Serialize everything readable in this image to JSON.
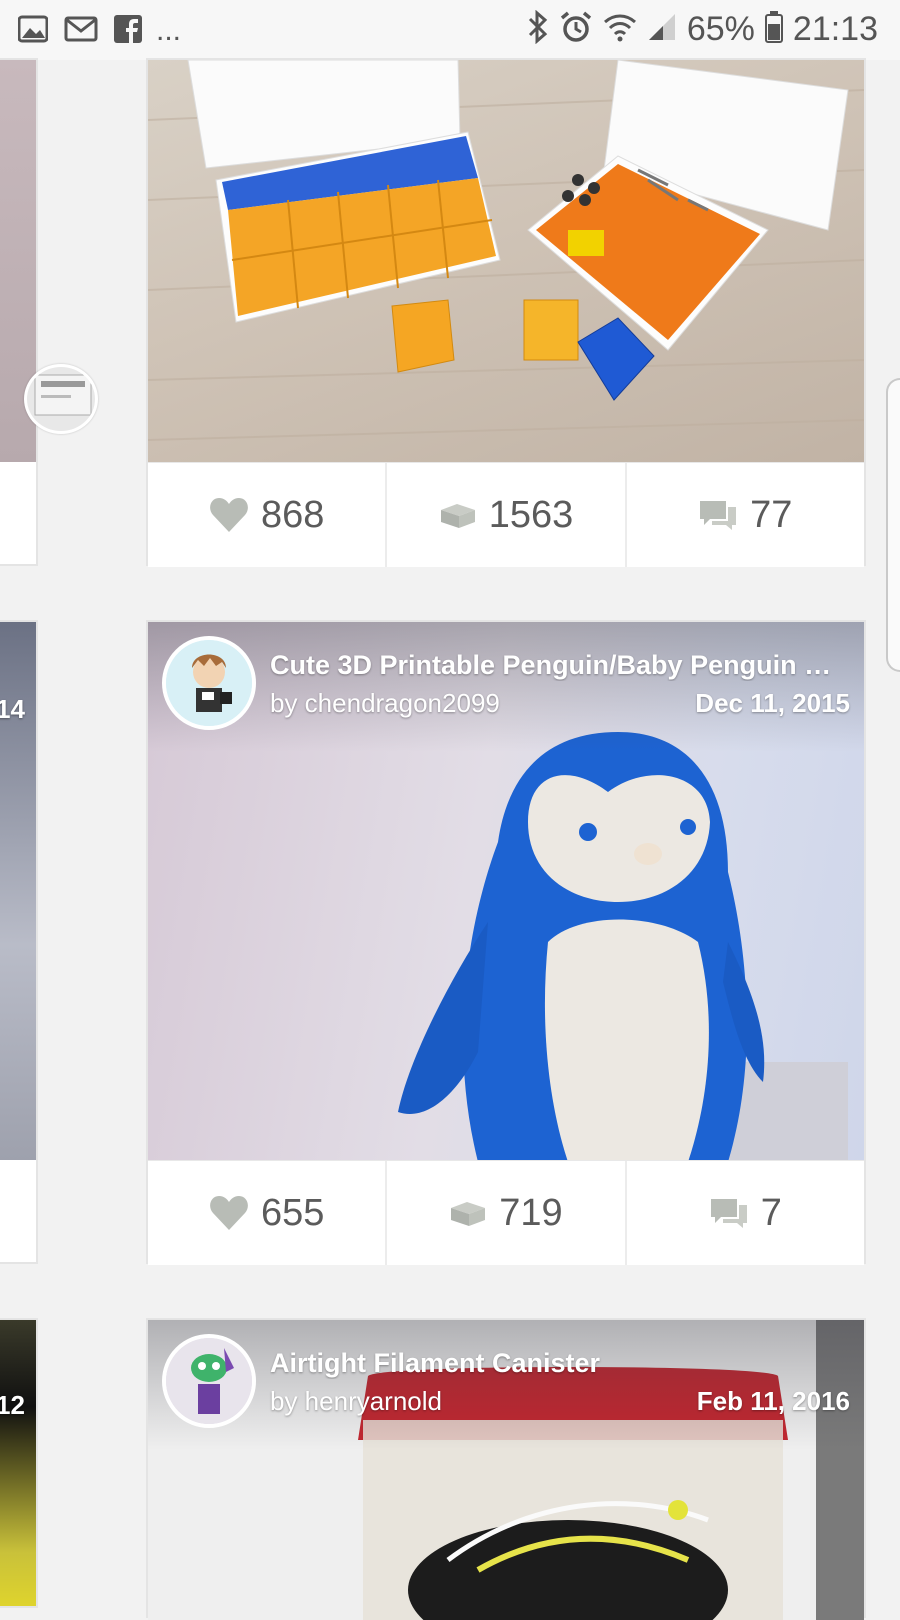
{
  "status_bar": {
    "left_icons": [
      "gallery-icon",
      "email-icon",
      "facebook-icon"
    ],
    "overflow": "...",
    "right_icons": [
      "bluetooth-icon",
      "alarm-icon",
      "wifi-icon",
      "signal-icon"
    ],
    "battery": "65%",
    "time": "21:13"
  },
  "feed": {
    "cards": [
      {
        "stats": {
          "likes": "868",
          "collections": "1563",
          "comments": "77"
        }
      },
      {
        "title": "Cute 3D Printable Penguin/Baby Penguin …",
        "author": "by chendragon2099",
        "date": "Dec 11, 2015",
        "stats": {
          "likes": "655",
          "collections": "719",
          "comments": "7"
        }
      },
      {
        "title": "Airtight Filament Canister",
        "author": "by henryarnold",
        "date": "Feb 11, 2016"
      }
    ],
    "left_column": {
      "label_1": "14",
      "label_2": "12"
    }
  },
  "colors": {
    "background": "#f2f2f2",
    "card": "#ffffff",
    "stat_icon": "#b8bcb6",
    "text": "#5b5b5b"
  }
}
